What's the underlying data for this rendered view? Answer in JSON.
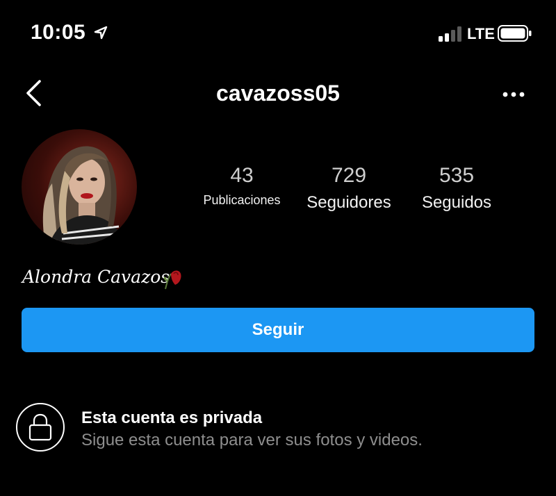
{
  "status_bar": {
    "time": "10:05",
    "network": "LTE",
    "icons": [
      "location-arrow-icon",
      "signal-bars-icon",
      "battery-icon"
    ]
  },
  "header": {
    "username": "cavazoss05",
    "back_icon": "chevron-left-icon",
    "more_icon": "more-horizontal-icon"
  },
  "profile": {
    "avatar": "profile-photo",
    "display_name": "Alondra Cavazos",
    "display_name_icon": "wilted-rose-icon",
    "stats": [
      {
        "value": "43",
        "label": "Publicaciones"
      },
      {
        "value": "729",
        "label": "Seguidores"
      },
      {
        "value": "535",
        "label": "Seguidos"
      }
    ]
  },
  "actions": {
    "follow_label": "Seguir"
  },
  "private_notice": {
    "icon": "lock-icon",
    "title": "Esta cuenta es privada",
    "subtitle": "Sigue esta cuenta para ver sus fotos y videos."
  },
  "colors": {
    "background": "#000000",
    "primary_button": "#1c97f3",
    "secondary_text": "#8e8e8e",
    "stat_value": "#cfcfcf"
  }
}
